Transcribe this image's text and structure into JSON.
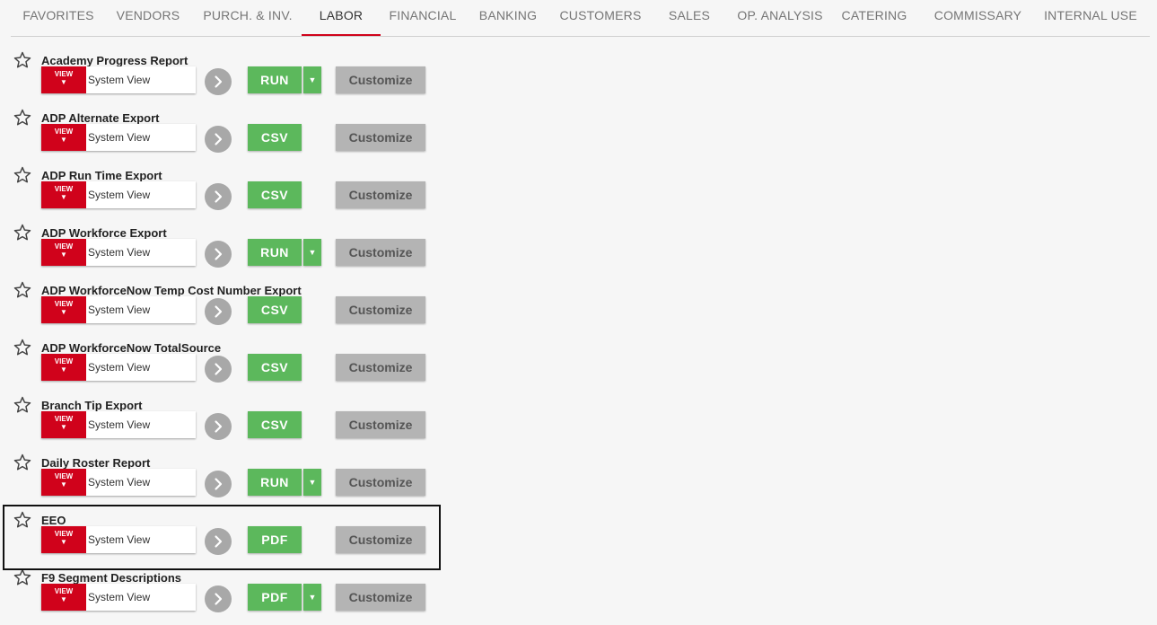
{
  "tabs": [
    {
      "label": "FAVORITES"
    },
    {
      "label": "VENDORS"
    },
    {
      "label": "PURCH. & INV."
    },
    {
      "label": "LABOR"
    },
    {
      "label": "FINANCIAL"
    },
    {
      "label": "BANKING"
    },
    {
      "label": "CUSTOMERS"
    },
    {
      "label": "SALES"
    },
    {
      "label": "OP. ANALYSIS"
    },
    {
      "label": "CATERING"
    },
    {
      "label": "COMMISSARY"
    },
    {
      "label": "INTERNAL USE"
    }
  ],
  "active_tab": "LABOR",
  "common": {
    "view_label": "VIEW",
    "view_arrow": "▼",
    "view_name": "System View",
    "customize_label": "Customize",
    "dropdown_arrow": "▼"
  },
  "reports": [
    {
      "title": "Academy Progress Report",
      "action": "RUN",
      "has_dropdown": true
    },
    {
      "title": "ADP Alternate Export",
      "action": "CSV",
      "has_dropdown": false
    },
    {
      "title": "ADP Run Time Export",
      "action": "CSV",
      "has_dropdown": false
    },
    {
      "title": "ADP Workforce Export",
      "action": "RUN",
      "has_dropdown": true
    },
    {
      "title": "ADP WorkforceNow Temp Cost Number Export",
      "action": "CSV",
      "has_dropdown": false
    },
    {
      "title": "ADP WorkforceNow TotalSource",
      "action": "CSV",
      "has_dropdown": false
    },
    {
      "title": "Branch Tip Export",
      "action": "CSV",
      "has_dropdown": false
    },
    {
      "title": "Daily Roster Report",
      "action": "RUN",
      "has_dropdown": true
    },
    {
      "title": "EEO",
      "action": "PDF",
      "has_dropdown": false,
      "highlighted": true
    },
    {
      "title": "F9 Segment Descriptions",
      "action": "PDF",
      "has_dropdown": true
    }
  ],
  "colors": {
    "accent_red": "#d0021b",
    "run_green": "#5cb85c",
    "customize_gray": "#b4b4b4",
    "go_gray": "#a8a8a8"
  },
  "icons": {
    "favorite": "star-outline-icon",
    "go": "chevron-right-icon",
    "view": "caret-down-icon"
  }
}
